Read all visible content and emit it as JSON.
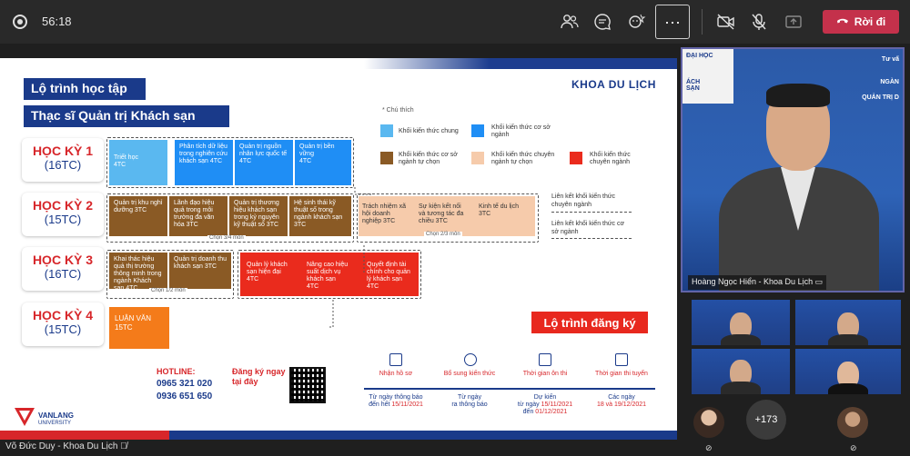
{
  "topbar": {
    "timer": "56:18",
    "leave_label": "Rời đi",
    "more_label": "···",
    "icons": [
      "record-icon",
      "participants-icon",
      "chat-icon",
      "reactions-icon",
      "more-icon",
      "camera-off-icon",
      "mic-off-icon",
      "share-icon",
      "phone-icon"
    ]
  },
  "slide": {
    "title_line1": "Lộ trình học tập",
    "title_line2": "Thạc sĩ Quản trị  Khách sạn",
    "faculty": "KHOA DU LỊCH",
    "semesters": [
      {
        "name": "HỌC KỲ 1",
        "credits": "(16TC)"
      },
      {
        "name": "HỌC KỲ 2",
        "credits": "(15TC)"
      },
      {
        "name": "HỌC KỲ 3",
        "credits": "(16TC)"
      },
      {
        "name": "HỌC KỲ 4",
        "credits": "(15TC)"
      }
    ],
    "hk1_cells": [
      "Triết học\n4TC",
      "Phân tích dữ liệu trong nghiên cứu khách sạn 4TC",
      "Quản trị nguồn nhân lực quốc tế\n4TC",
      "Quản trị bền vững\n4TC"
    ],
    "hk2_cells": [
      "Quản trị khu nghỉ dưỡng 3TC",
      "Lãnh đạo hiệu quả trong môi trường đa văn hóa 3TC",
      "Quản trị thương hiệu khách sạn trong kỷ nguyên kỹ thuật số 3TC",
      "Hệ sinh thái kỹ thuật số trong ngành khách sạn 3TC"
    ],
    "hk2_note": "Chọn 3/4 môn",
    "hk2_peach_cells": [
      "Trách nhiệm xã hội doanh nghiệp 3TC",
      "Sự kiện kết nối và tương tác đa chiều 3TC",
      "Kinh tế du lịch\n3TC"
    ],
    "hk2_peach_note": "Chọn 2/3 môn",
    "hk3_brown_cells": [
      "Khai thác hiệu quả thị trường thông minh trong ngành Khách sạn 4TC",
      "Quản trị doanh thu khách sạn 3TC"
    ],
    "hk3_note": "Chọn 1/2 môn",
    "hk3_red_cells": [
      "Quản lý khách sạn hiện đại\n4TC",
      "Nâng cao hiệu suất dịch vụ khách sạn\n4TC",
      "Quyết định tài chính cho quản lý khách sạn\n4TC"
    ],
    "hk4_cell": "LUẬN VĂN\n15TC",
    "legend_title": "* Chú thích",
    "legend": [
      {
        "label": "Khối kiến thức chung",
        "color": "#5ab8f0"
      },
      {
        "label": "Khối kiến thức cơ sở ngành",
        "color": "#1f8ef5"
      },
      {
        "label": "Khối kiến thức cơ sở ngành tự chọn",
        "color": "#8a5a25"
      },
      {
        "label": "Khối kiến thức chuyên ngành tự chọn",
        "color": "#f6cbab"
      },
      {
        "label": "Khối kiến thức chuyên ngành",
        "color": "#ea2b1d"
      }
    ],
    "link1": "Liên kết khối kiến thức chuyên ngành",
    "link2": "Liên kết khối kiến thức cơ sở ngành",
    "registration_title": "Lộ trình đăng ký",
    "hotline_label": "HOTLINE:",
    "hotline_1": "0965 321 020",
    "hotline_2": "0936 651 650",
    "register_here": "Đăng ký ngay tại đây",
    "steps": [
      {
        "title": "Nhận hồ sơ",
        "desc_a": "Từ ngày thông báo",
        "desc_b": "đến hết ",
        "date": "15/11/2021"
      },
      {
        "title": "Bổ sung kiến thức",
        "desc_a": "Từ ngày",
        "desc_b": "ra thông báo",
        "date": ""
      },
      {
        "title": "Thời gian ôn thi",
        "desc_a": "Dự kiến",
        "desc_b": "từ ngày ",
        "date": "15/11/2021",
        "desc_c": "đến ",
        "date2": "01/12/2021"
      },
      {
        "title": "Thời gian thi tuyển",
        "desc_a": "Các ngày",
        "desc_b": "",
        "date": "18 và 19/12/2021"
      }
    ],
    "logo_name": "VANLANG",
    "logo_sub": "UNIVERSITY"
  },
  "presenter": {
    "name": "Võ Đức Duy - Khoa Du Lịch"
  },
  "speaker": {
    "name": "Hoàng Ngọc Hiển - Khoa Du Lịch",
    "sign_left": "ĐẠI HỌC",
    "sign_right_a": "Tư vấ",
    "sign_right_b": "NGÀN",
    "sign_right_c": "QUẢN TRỊ D",
    "sign_left_b": "ÁCH",
    "sign_left_c": "SẠN"
  },
  "others_count": "+173"
}
